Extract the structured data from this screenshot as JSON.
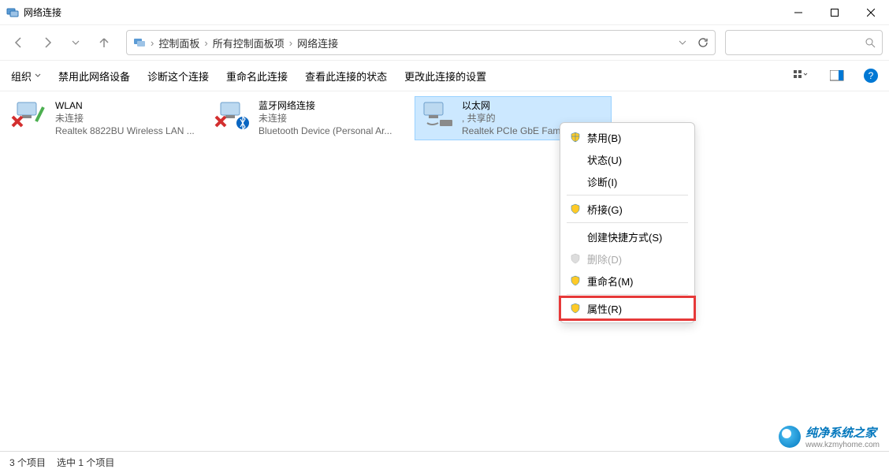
{
  "window": {
    "title": "网络连接"
  },
  "breadcrumb": {
    "items": [
      "控制面板",
      "所有控制面板项",
      "网络连接"
    ]
  },
  "toolbar": {
    "organize": "组织",
    "disable": "禁用此网络设备",
    "diagnose": "诊断这个连接",
    "rename": "重命名此连接",
    "status": "查看此连接的状态",
    "settings": "更改此连接的设置"
  },
  "connections": [
    {
      "name": "WLAN",
      "status": "未连接",
      "device": "Realtek 8822BU Wireless LAN ..."
    },
    {
      "name": "蓝牙网络连接",
      "status": "未连接",
      "device": "Bluetooth Device (Personal Ar..."
    },
    {
      "name": "以太网",
      "status": ", 共享的",
      "device": "Realtek PCIe GbE Famil"
    }
  ],
  "context_menu": {
    "disable": "禁用(B)",
    "status": "状态(U)",
    "diagnose": "诊断(I)",
    "bridge": "桥接(G)",
    "shortcut": "创建快捷方式(S)",
    "delete": "删除(D)",
    "rename": "重命名(M)",
    "properties": "属性(R)"
  },
  "statusbar": {
    "count": "3 个项目",
    "selected": "选中 1 个项目"
  },
  "watermark": {
    "text": "纯净系统之家",
    "url": "www.kzmyhome.com"
  }
}
